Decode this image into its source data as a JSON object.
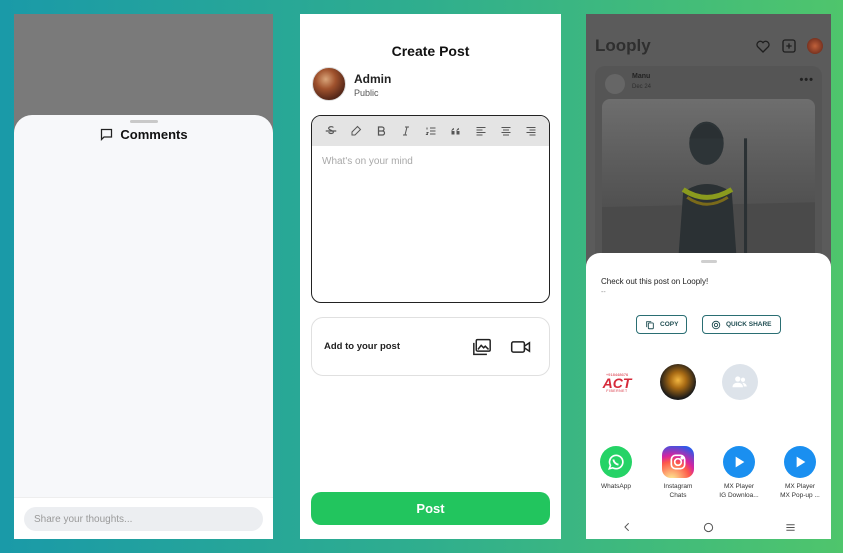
{
  "comments_screen": {
    "sheet_title": "Comments",
    "input_placeholder": "Share your thoughts..."
  },
  "create_post_screen": {
    "title": "Create Post",
    "user": {
      "name": "Admin",
      "visibility": "Public"
    },
    "toolbar_icons": [
      "strikethrough-icon",
      "eraser-icon",
      "bold-icon",
      "italic-icon",
      "ordered-list-icon",
      "quote-icon",
      "align-left-icon",
      "align-center-icon",
      "align-right-icon"
    ],
    "editor_placeholder": "What's on your mind",
    "add_to_post_label": "Add to your post",
    "post_button": "Post",
    "accent_color": "#22c55e"
  },
  "share_screen": {
    "app_name": "Looply",
    "feed_post": {
      "user": "Manu",
      "date": "Dec 24",
      "more": "•••"
    },
    "share_message": "Check out this post on Looply!",
    "share_subtext": "--",
    "copy_button": "COPY",
    "quick_share_button": "QUICK SHARE",
    "recent_targets": [
      {
        "icon": "act-fibernet-logo"
      },
      {
        "icon": "contact-avatar"
      },
      {
        "icon": "group-icon"
      }
    ],
    "apps": [
      {
        "label_line1": "WhatsApp",
        "label_line2": "",
        "icon": "whatsapp-icon"
      },
      {
        "label_line1": "Instagram",
        "label_line2": "Chats",
        "icon": "instagram-icon"
      },
      {
        "label_line1": "MX Player",
        "label_line2": "IG Downloa...",
        "icon": "mx-player-icon"
      },
      {
        "label_line1": "MX Player",
        "label_line2": "MX Pop-up ...",
        "icon": "mx-player-icon"
      }
    ],
    "act_logo_text": {
      "top": "+918448676",
      "main": "ACT",
      "bottom": "FIBERNET"
    }
  }
}
